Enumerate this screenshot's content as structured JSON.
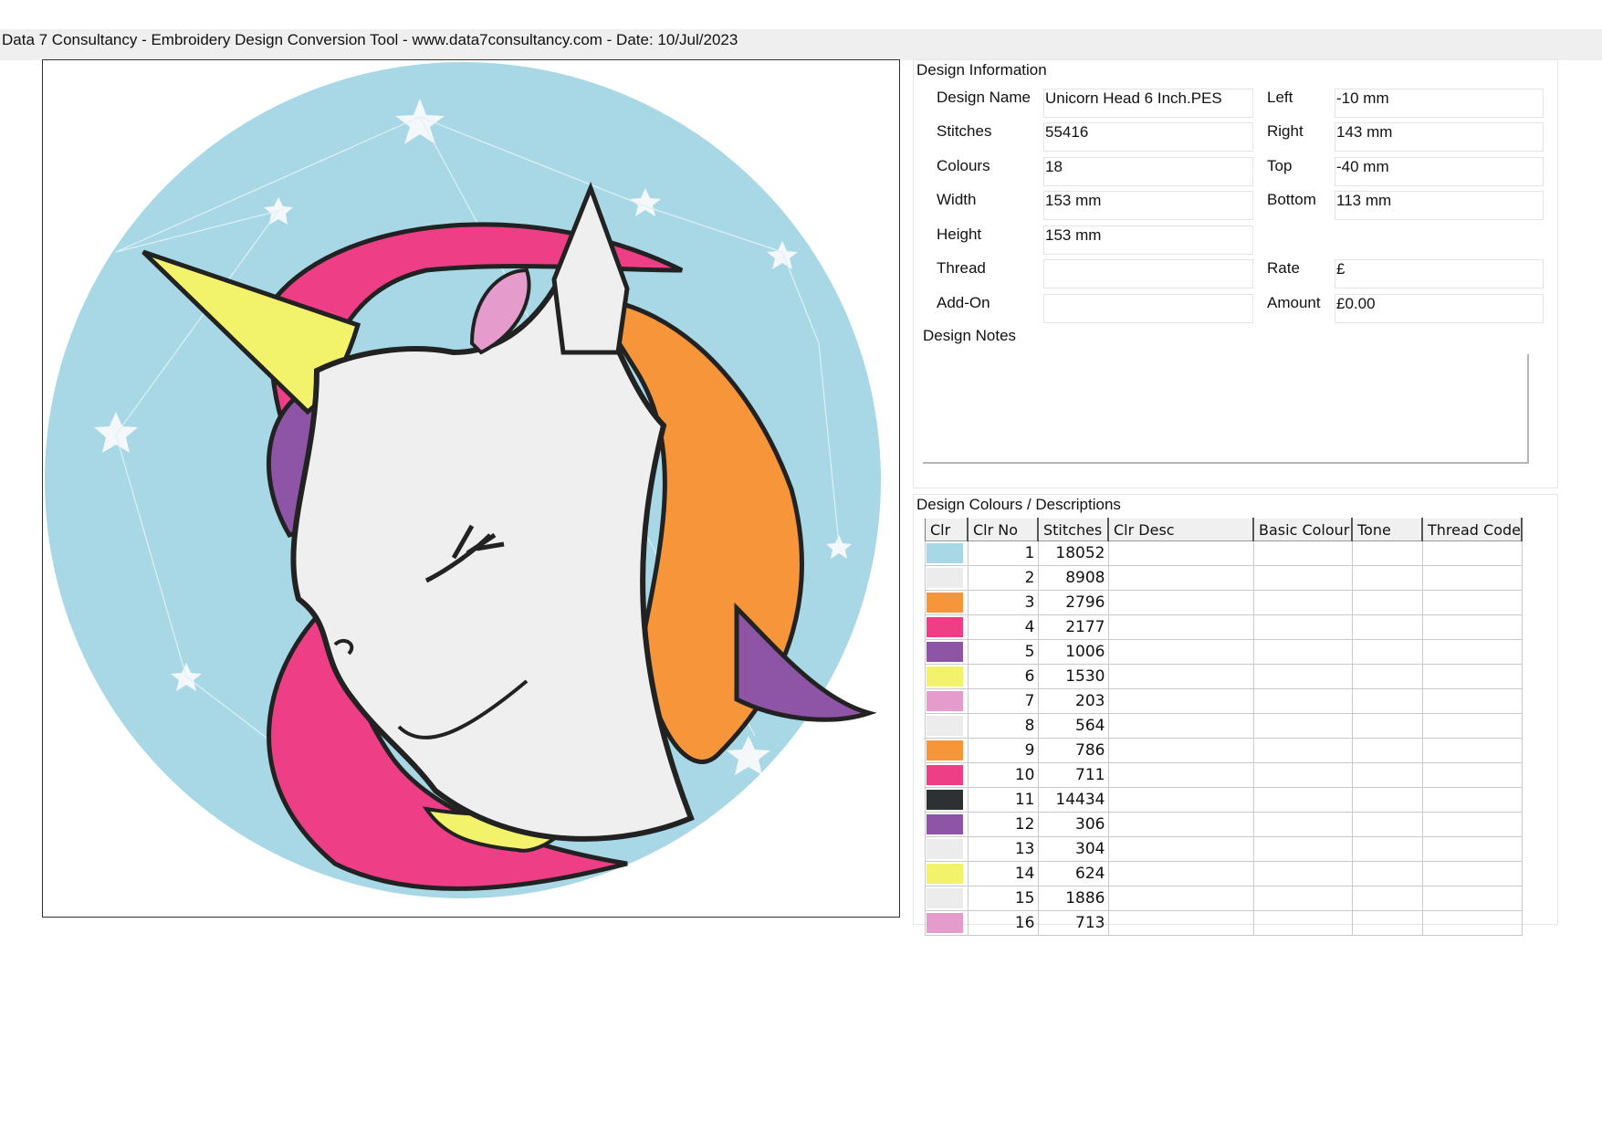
{
  "header": {
    "text": "Data 7 Consultancy - Embroidery Design Conversion Tool - www.data7consultancy.com - Date: 10/Jul/2023"
  },
  "design_info": {
    "title": "Design Information",
    "design_name_label": "Design Name",
    "design_name": "Unicorn Head 6 Inch.PES",
    "stitches_label": "Stitches",
    "stitches": "55416",
    "colours_label": "Colours",
    "colours": "18",
    "width_label": "Width",
    "width": "153 mm",
    "height_label": "Height",
    "height": "153 mm",
    "thread_label": "Thread",
    "thread": "",
    "addon_label": "Add-On",
    "addon": "",
    "left_label": "Left",
    "left": "-10 mm",
    "right_label": "Right",
    "right": "143 mm",
    "top_label": "Top",
    "top": "-40 mm",
    "bottom_label": "Bottom",
    "bottom": "113 mm",
    "rate_label": "Rate",
    "rate": "£",
    "amount_label": "Amount",
    "amount": "£0.00",
    "notes_label": "Design Notes",
    "notes": ""
  },
  "colours": {
    "title": "Design Colours / Descriptions",
    "columns": [
      "Clr",
      "Clr No",
      "Stitches",
      "Clr Desc",
      "Basic Colour",
      "Tone",
      "Thread Code"
    ],
    "rows": [
      {
        "color": "#a8d8e6",
        "no": "1",
        "stitches": "18052"
      },
      {
        "color": "#ececec",
        "no": "2",
        "stitches": "8908"
      },
      {
        "color": "#f7953a",
        "no": "3",
        "stitches": "2796"
      },
      {
        "color": "#ee3f86",
        "no": "4",
        "stitches": "2177"
      },
      {
        "color": "#8e55a6",
        "no": "5",
        "stitches": "1006"
      },
      {
        "color": "#f3f36b",
        "no": "6",
        "stitches": "1530"
      },
      {
        "color": "#e59ccc",
        "no": "7",
        "stitches": "203"
      },
      {
        "color": "#ececec",
        "no": "8",
        "stitches": "564"
      },
      {
        "color": "#f7953a",
        "no": "9",
        "stitches": "786"
      },
      {
        "color": "#ee3f86",
        "no": "10",
        "stitches": "711"
      },
      {
        "color": "#2d3134",
        "no": "11",
        "stitches": "14434"
      },
      {
        "color": "#8e55a6",
        "no": "12",
        "stitches": "306"
      },
      {
        "color": "#ececec",
        "no": "13",
        "stitches": "304"
      },
      {
        "color": "#f3f36b",
        "no": "14",
        "stitches": "624"
      },
      {
        "color": "#ececec",
        "no": "15",
        "stitches": "1886"
      },
      {
        "color": "#e59ccc",
        "no": "16",
        "stitches": "713"
      }
    ]
  }
}
